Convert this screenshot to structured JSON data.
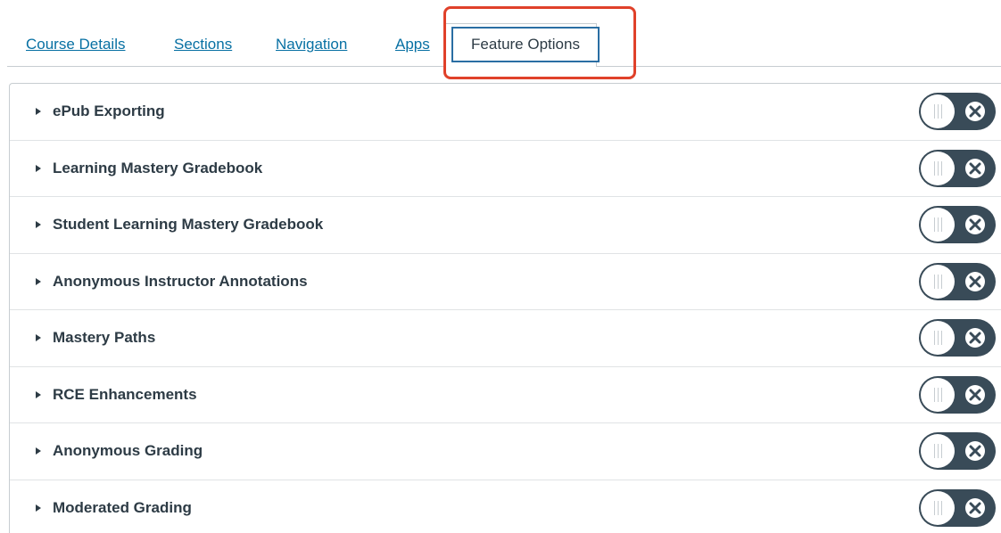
{
  "tabs": {
    "course_details": "Course Details",
    "sections": "Sections",
    "navigation": "Navigation",
    "apps": "Apps",
    "feature_options": "Feature Options"
  },
  "features": [
    {
      "label": "ePub Exporting",
      "enabled": false
    },
    {
      "label": "Learning Mastery Gradebook",
      "enabled": false
    },
    {
      "label": "Student Learning Mastery Gradebook",
      "enabled": false
    },
    {
      "label": "Anonymous Instructor Annotations",
      "enabled": false
    },
    {
      "label": "Mastery Paths",
      "enabled": false
    },
    {
      "label": "RCE Enhancements",
      "enabled": false
    },
    {
      "label": "Anonymous Grading",
      "enabled": false
    },
    {
      "label": "Moderated Grading",
      "enabled": false
    }
  ],
  "colors": {
    "link": "#0770a3",
    "highlight": "#e0412a",
    "toggle_off": "#394b58",
    "text": "#2d3b45"
  }
}
